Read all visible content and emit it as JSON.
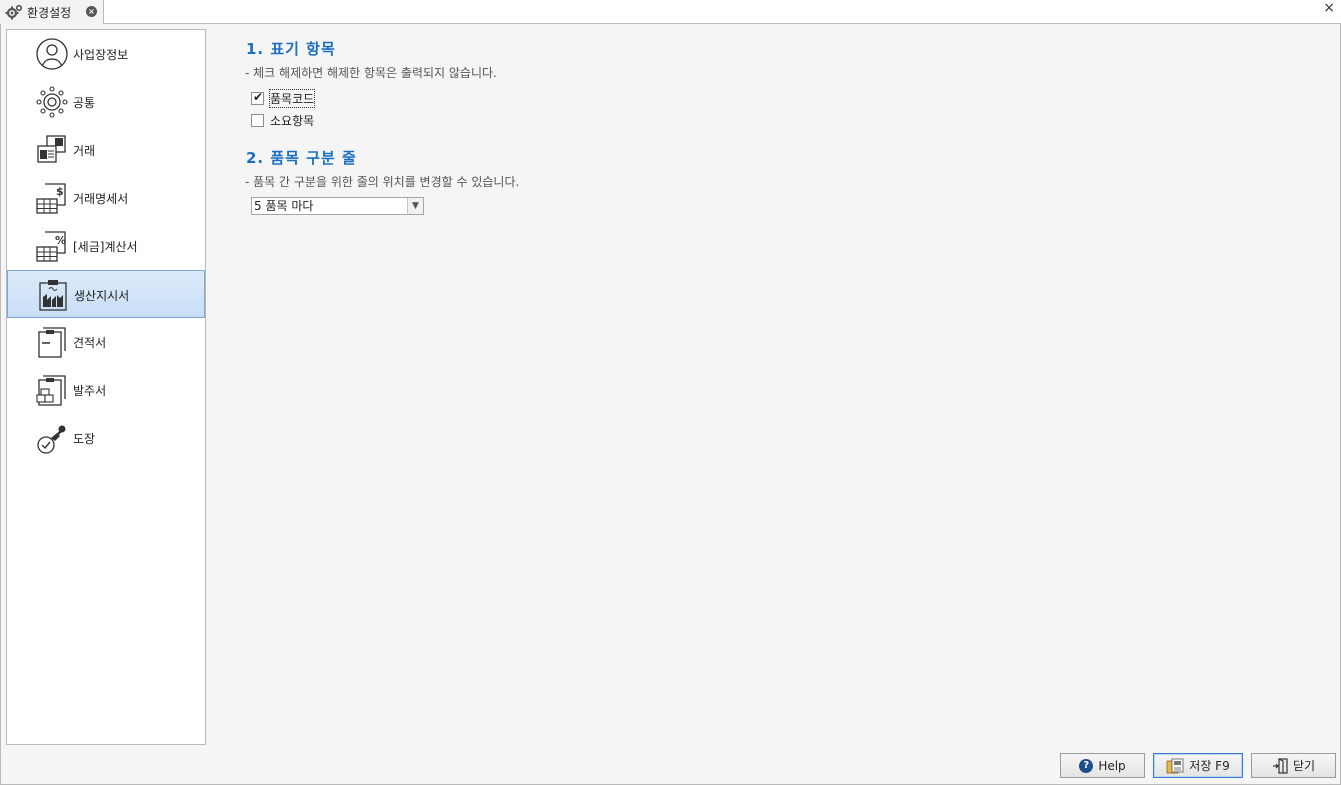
{
  "window": {
    "tab_label": "환경설정",
    "close_glyph": "×"
  },
  "sidebar": {
    "items": [
      {
        "label": "사업장정보",
        "icon": "person-circle-icon"
      },
      {
        "label": "공통",
        "icon": "sun-settings-icon"
      },
      {
        "label": "거래",
        "icon": "transaction-doc-icon"
      },
      {
        "label": "거래명세서",
        "icon": "statement-dollar-icon"
      },
      {
        "label": "[세금]계산서",
        "icon": "tax-invoice-percent-icon"
      },
      {
        "label": "생산지시서",
        "icon": "factory-clipboard-icon"
      },
      {
        "label": "견적서",
        "icon": "estimate-doc-icon"
      },
      {
        "label": "발주서",
        "icon": "purchase-order-box-icon"
      },
      {
        "label": "도장",
        "icon": "stamp-check-icon"
      }
    ],
    "selected": "생산지시서"
  },
  "section1": {
    "title": "1. 표기 항목",
    "desc": "- 체크 해제하면 해제한 항목은 출력되지 않습니다.",
    "checkboxes": [
      {
        "label": "품목코드",
        "checked": true
      },
      {
        "label": "소요항목",
        "checked": false
      }
    ]
  },
  "section2": {
    "title": "2. 품목 구분 줄",
    "desc": "- 품목 간 구분을 위한 줄의 위치를 변경할 수 있습니다.",
    "select_value": "5 품목 마다"
  },
  "buttons": {
    "help": "Help",
    "save": "저장 F9",
    "close": "닫기"
  },
  "colors": {
    "accent": "#1b6fc0",
    "selected_bg": "#cfe2f7"
  }
}
